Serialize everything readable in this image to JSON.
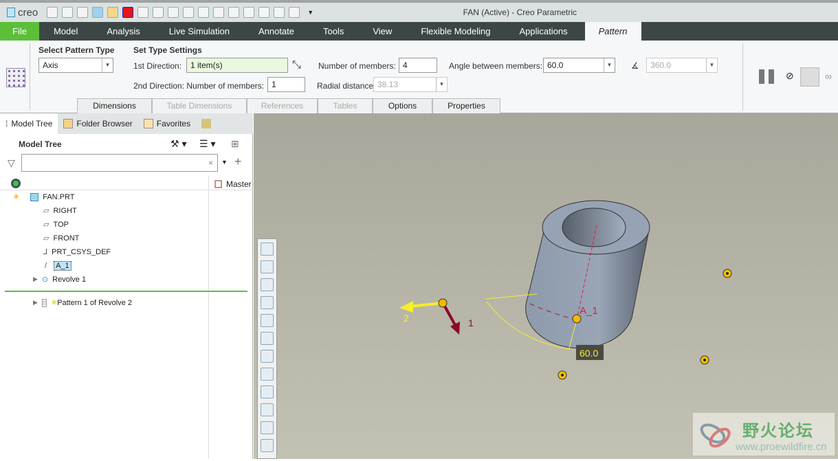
{
  "app": {
    "logo": "creo",
    "title": "FAN (Active) - Creo Parametric"
  },
  "menu": [
    "File",
    "Model",
    "Analysis",
    "Live Simulation",
    "Annotate",
    "Tools",
    "View",
    "Flexible Modeling",
    "Applications",
    "Pattern"
  ],
  "ribbon": {
    "select_type_label": "Select Pattern Type",
    "type_value": "Axis",
    "settings_label": "Set Type Settings",
    "dir1_label": "1st Direction:",
    "dir1_value": "1 item(s)",
    "members_label": "Number of members:",
    "members_value": "4",
    "angle_label": "Angle between members:",
    "angle_value": "60.0",
    "total_angle_value": "360.0",
    "dir2_label": "2nd Direction: Number of members:",
    "dir2_value": "1",
    "radial_label": "Radial distance:",
    "radial_value": "38.13",
    "tabs": [
      "Dimensions",
      "Table Dimensions",
      "References",
      "Tables",
      "Options",
      "Properties"
    ]
  },
  "panel": {
    "tabs": [
      "Model Tree",
      "Folder Browser",
      "Favorites"
    ],
    "title": "Model Tree",
    "search_placeholder": "",
    "column": "Master",
    "items": [
      "FAN.PRT",
      "RIGHT",
      "TOP",
      "FRONT",
      "PRT_CSYS_DEF",
      "A_1",
      "Revolve 1",
      "Pattern 1 of Revolve 2"
    ]
  },
  "viewport": {
    "dir2": "2",
    "dir1": "1",
    "axis": "A_1",
    "angle_dim": "60.0"
  },
  "watermark": {
    "name": "野火论坛",
    "url": "www.proewildfire.cn"
  },
  "colors": {
    "file_tab": "#5bbf3a",
    "menubar": "#3d4647",
    "highlight_field": "#eaf8df",
    "dim_yellow": "#f5ef2a",
    "axis_red": "#e0203a"
  }
}
